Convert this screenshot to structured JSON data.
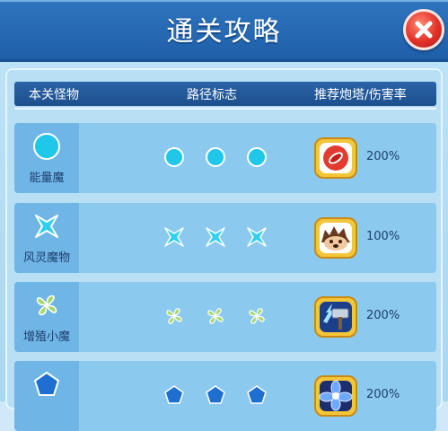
{
  "title": "通关攻略",
  "columns": {
    "monster": "本关怪物",
    "path_marker": "路径标志",
    "tower_rate": "推荐炮塔/伤害率"
  },
  "rows": [
    {
      "monster": "能量魔",
      "icon": "circle-icon",
      "color": "#1fc7e8",
      "tower": "red-pepper-tower-icon",
      "rate": "200%"
    },
    {
      "monster": "风灵魔物",
      "icon": "four-point-star-icon",
      "color": "#2fd0f0",
      "tower": "hedgehog-tower-icon",
      "rate": "100%"
    },
    {
      "monster": "增殖小魔",
      "icon": "four-leaf-icon",
      "color": "#a8d86a",
      "tower": "thunder-hammer-tower-icon",
      "rate": "200%"
    },
    {
      "monster": "",
      "icon": "pentagon-icon",
      "color": "#1e6fd0",
      "tower": "blue-flower-tower-icon",
      "rate": "200%"
    }
  ]
}
